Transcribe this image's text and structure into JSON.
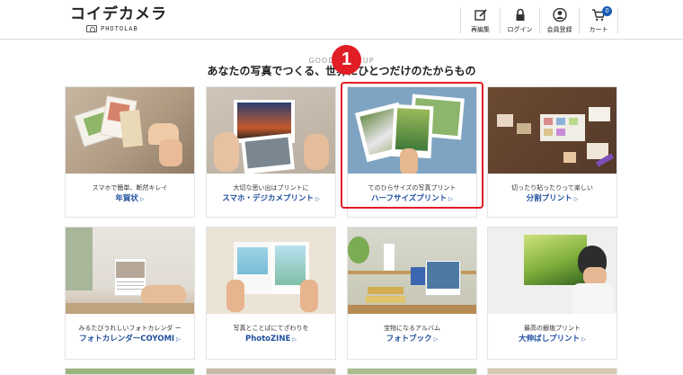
{
  "header": {
    "logo_text": "コイデカメラ",
    "logo_sub": "PHOTOLAB",
    "nav": [
      {
        "label": "再編集",
        "icon": "edit-icon"
      },
      {
        "label": "ログイン",
        "icon": "lock-icon"
      },
      {
        "label": "会員登録",
        "icon": "user-icon"
      },
      {
        "label": "カート",
        "icon": "cart-icon",
        "badge": "0"
      }
    ]
  },
  "section": {
    "subtitle": "GOODS LINEUP",
    "title": "あなたの写真でつくる、世界にひとつだけのたからもの"
  },
  "products": [
    {
      "desc": "スマホで簡単、断然キレイ",
      "name": "年賀状"
    },
    {
      "desc": "大切な思い出はプリントに",
      "name": "スマホ・デジカメプリント"
    },
    {
      "desc": "てのひらサイズの写真プリント",
      "name": "ハーフサイズプリント"
    },
    {
      "desc": "切ったり貼ったりって楽しい",
      "name": "分割プリント"
    },
    {
      "desc": "みるたびうれしいフォトカレンダ ー",
      "name": "フォトカレンダーCOYOMI"
    },
    {
      "desc": "写真とことばにてざわりを",
      "name": "PhotoZINE"
    },
    {
      "desc": "宝物になるアルバム",
      "name": "フォトブック"
    },
    {
      "desc": "最高の銀塩プリント",
      "name": "大伸ばしプリント"
    }
  ],
  "annotation": {
    "marker": "1"
  }
}
